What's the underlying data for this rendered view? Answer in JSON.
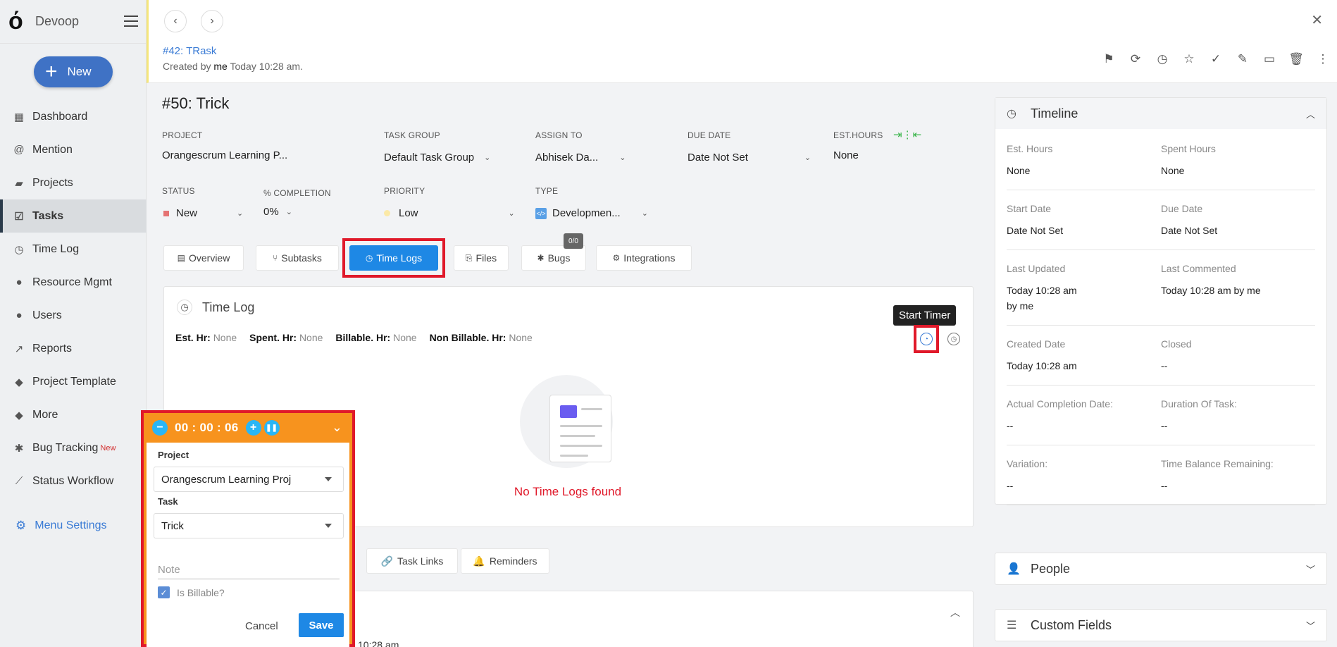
{
  "brand": {
    "name": "Devoop"
  },
  "new_button": {
    "label": "New"
  },
  "sidebar": {
    "items": [
      {
        "label": "Dashboard",
        "icon": "dashboard-icon"
      },
      {
        "label": "Mention",
        "icon": "at-icon"
      },
      {
        "label": "Projects",
        "icon": "briefcase-icon"
      },
      {
        "label": "Tasks",
        "icon": "tasks-icon",
        "active": true
      },
      {
        "label": "Time Log",
        "icon": "clock-icon"
      },
      {
        "label": "Resource Mgmt",
        "icon": "resource-icon"
      },
      {
        "label": "Users",
        "icon": "user-icon"
      },
      {
        "label": "Reports",
        "icon": "chart-line-icon"
      },
      {
        "label": "Project Template",
        "icon": "layers-icon"
      },
      {
        "label": "More",
        "icon": "layers-icon"
      },
      {
        "label": "Bug Tracking",
        "icon": "bug-icon",
        "badge": "New"
      },
      {
        "label": "Status Workflow",
        "icon": "workflow-icon"
      }
    ],
    "menu_settings": "Menu Settings"
  },
  "header": {
    "parent_task": "#42: TRask",
    "created_prefix": "Created by",
    "created_by": "me",
    "created_time": "Today 10:28 am."
  },
  "task": {
    "title": "#50: Trick",
    "fields": {
      "project_label": "PROJECT",
      "project_value": "Orangescrum Learning P...",
      "taskgroup_label": "TASK GROUP",
      "taskgroup_value": "Default Task Group",
      "assign_label": "ASSIGN TO",
      "assign_value": "Abhisek Da...",
      "due_label": "DUE DATE",
      "due_value": "Date Not Set",
      "esthours_label": "EST.HOURS",
      "esthours_value": "None",
      "status_label": "STATUS",
      "status_value": "New",
      "completion_label": "% COMPLETION",
      "completion_value": "0%",
      "priority_label": "PRIORITY",
      "priority_value": "Low",
      "type_label": "TYPE",
      "type_value": "Developmen..."
    }
  },
  "tabs": [
    {
      "label": "Overview"
    },
    {
      "label": "Subtasks"
    },
    {
      "label": "Time Logs",
      "active": true
    },
    {
      "label": "Files"
    },
    {
      "label": "Bugs",
      "badge": "0/0"
    },
    {
      "label": "Integrations"
    }
  ],
  "timelog": {
    "title": "Time Log",
    "est_label": "Est. Hr:",
    "est_value": "None",
    "spent_label": "Spent. Hr:",
    "spent_value": "None",
    "billable_label": "Billable. Hr:",
    "billable_value": "None",
    "nonbillable_label": "Non Billable. Hr:",
    "nonbillable_value": "None",
    "tooltip": "Start Timer",
    "empty": "No Time Logs found"
  },
  "lower_tabs": [
    {
      "label": "Task Links"
    },
    {
      "label": "Reminders"
    }
  ],
  "lower_panel": {
    "peek": "10:28 am"
  },
  "timeline": {
    "title": "Timeline",
    "rows": [
      [
        {
          "label": "Est. Hours",
          "value": "None"
        },
        {
          "label": "Spent Hours",
          "value": "None"
        }
      ],
      [
        {
          "label": "Start Date",
          "value": "Date Not Set"
        },
        {
          "label": "Due Date",
          "value": "Date Not Set"
        }
      ],
      [
        {
          "label": "Last Updated",
          "value": "Today 10:28 am",
          "value2": "by me"
        },
        {
          "label": "Last Commented",
          "value": "Today 10:28 am by me"
        }
      ],
      [
        {
          "label": "Created Date",
          "value": "Today 10:28 am"
        },
        {
          "label": "Closed",
          "value": "--"
        }
      ],
      [
        {
          "label": "Actual Completion Date:",
          "value": "--"
        },
        {
          "label": "Duration Of Task:",
          "value": "--"
        }
      ],
      [
        {
          "label": "Variation:",
          "value": "--"
        },
        {
          "label": "Time Balance Remaining:",
          "value": "--"
        }
      ]
    ]
  },
  "people": {
    "title": "People"
  },
  "custom_fields": {
    "title": "Custom Fields"
  },
  "timer": {
    "time": "00 : 00 : 06",
    "project_label": "Project",
    "project_value": "Orangescrum Learning Proj",
    "task_label": "Task",
    "task_value": "Trick",
    "note_placeholder": "Note",
    "billable_label": "Is Billable?",
    "billable_checked": true,
    "cancel": "Cancel",
    "save": "Save"
  },
  "colors": {
    "accent": "#1e88e5",
    "highlight": "#e0192a",
    "timer_bg": "#f7931e"
  }
}
